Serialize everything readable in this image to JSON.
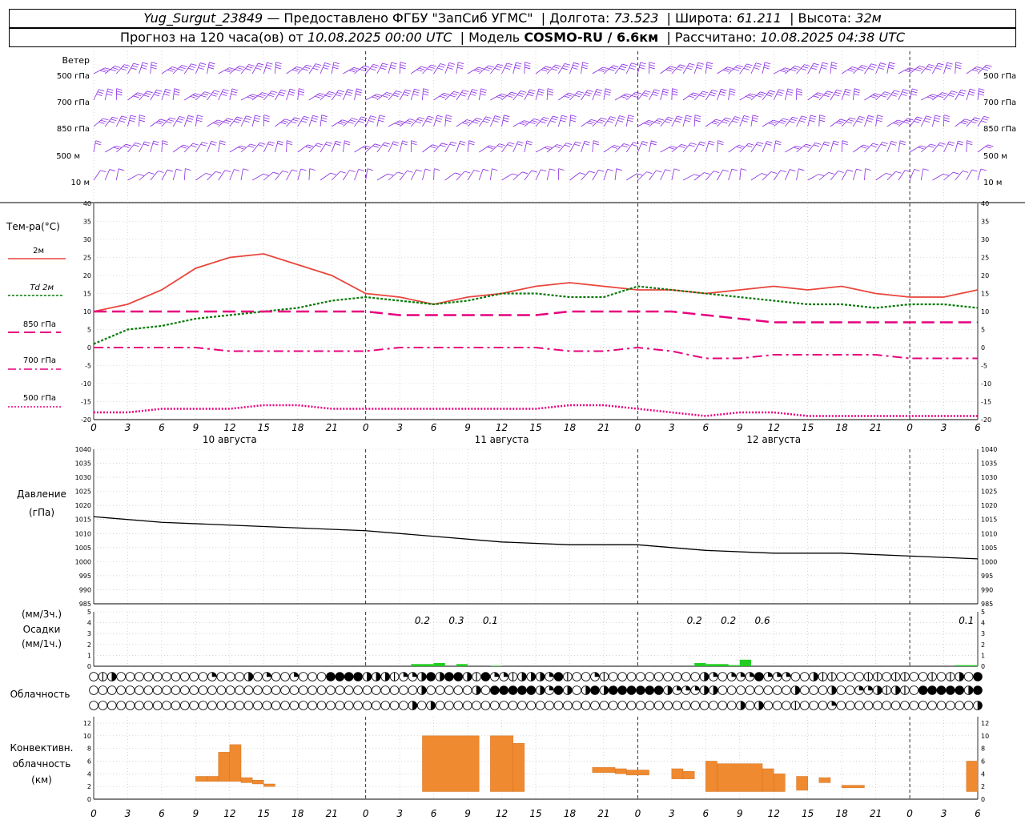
{
  "header": {
    "station": "Yug_Surgut_23849",
    "provider": "— Предоставлено ФГБУ \"ЗапСиб УГМС\"",
    "lon_label": "Долгота:",
    "lon_value": "73.523",
    "lat_label": "Широта:",
    "lat_value": "61.211",
    "alt_label": "Высота:",
    "alt_value": "32м",
    "forecast_prefix": "Прогноз на 120 часа(ов) от",
    "forecast_start": "10.08.2025 00:00 UTC",
    "model_label": "Модель",
    "model_value": "COSMO-RU / 6.6км",
    "calc_label": "Рассчитано:",
    "calc_value": "10.08.2025 04:38 UTC"
  },
  "wind_panel": {
    "title": "Ветер",
    "levels": [
      "500 гПа",
      "700 гПа",
      "850 гПа",
      "500 м",
      "10 м"
    ]
  },
  "axis": {
    "hour_labels": [
      "0",
      "3",
      "6",
      "9",
      "12",
      "15",
      "18",
      "21",
      "0",
      "3",
      "6",
      "9",
      "12",
      "15",
      "18",
      "21",
      "0",
      "3",
      "6",
      "9",
      "12",
      "15",
      "18",
      "21",
      "0",
      "3",
      "6"
    ],
    "day_labels": [
      "10 августа",
      "11 августа",
      "12 августа"
    ]
  },
  "colors": {
    "wind": "#8a2be2",
    "t2m": "#e8463c",
    "td2m": "#0a7a0a",
    "t850": "#e6007e",
    "pressure": "#000000",
    "precip": "#22cc22",
    "convective": "#f08a30"
  },
  "chart_data": [
    {
      "type": "line",
      "title": "Тем-ра(°C)",
      "ylim": [
        -20,
        40
      ],
      "y_ticks": [
        40,
        35,
        30,
        25,
        20,
        15,
        10,
        5,
        0,
        -5,
        -10,
        -15,
        -20
      ],
      "x_hours": [
        0,
        3,
        6,
        9,
        12,
        15,
        18,
        21,
        24,
        27,
        30,
        33,
        36,
        39,
        42,
        45,
        48,
        51,
        54,
        57,
        60,
        63,
        66,
        69,
        72,
        75,
        78
      ],
      "series": [
        {
          "name": "2м",
          "values": [
            10,
            12,
            16,
            22,
            25,
            26,
            23,
            20,
            15,
            14,
            12,
            14,
            15,
            17,
            18,
            17,
            16,
            16,
            15,
            16,
            17,
            16,
            17,
            15,
            14,
            14,
            16
          ]
        },
        {
          "name": "Td 2м",
          "values": [
            1,
            5,
            6,
            8,
            9,
            10,
            11,
            13,
            14,
            13,
            12,
            13,
            15,
            15,
            14,
            14,
            17,
            16,
            15,
            14,
            13,
            12,
            12,
            11,
            12,
            12,
            11
          ]
        },
        {
          "name": "850 гПа",
          "values": [
            10,
            10,
            10,
            10,
            10,
            10,
            10,
            10,
            10,
            9,
            9,
            9,
            9,
            9,
            10,
            10,
            10,
            10,
            9,
            8,
            7,
            7,
            7,
            7,
            7,
            7,
            7
          ]
        },
        {
          "name": "700 гПа",
          "values": [
            0,
            0,
            0,
            0,
            -1,
            -1,
            -1,
            -1,
            -1,
            0,
            0,
            0,
            0,
            0,
            -1,
            -1,
            0,
            -1,
            -3,
            -3,
            -2,
            -2,
            -2,
            -2,
            -3,
            -3,
            -3
          ]
        },
        {
          "name": "500 гПа",
          "values": [
            -18,
            -18,
            -17,
            -17,
            -17,
            -16,
            -16,
            -17,
            -17,
            -17,
            -17,
            -17,
            -17,
            -17,
            -16,
            -16,
            -17,
            -18,
            -19,
            -18,
            -18,
            -19,
            -19,
            -19,
            -19,
            -19,
            -19
          ]
        }
      ]
    },
    {
      "type": "line",
      "title": "Давление",
      "ylabel": "(гПа)",
      "ylim": [
        985,
        1040
      ],
      "y_ticks": [
        1040,
        1035,
        1030,
        1025,
        1020,
        1015,
        1010,
        1005,
        1000,
        995,
        990,
        985
      ],
      "x_hours": [
        0,
        6,
        12,
        18,
        24,
        30,
        36,
        42,
        48,
        54,
        60,
        66,
        72,
        78
      ],
      "series": [
        {
          "values": [
            1016,
            1014,
            1013,
            1012,
            1011,
            1009,
            1007,
            1006,
            1006,
            1004,
            1003,
            1003,
            1002,
            1001
          ]
        }
      ]
    },
    {
      "type": "bar",
      "title": "Осадки",
      "ylabel_top": "(мм/3ч.)",
      "ylabel_bottom": "(мм/1ч.)",
      "ylim": [
        0,
        5
      ],
      "y_ticks": [
        5,
        4,
        3,
        2,
        1,
        0
      ],
      "labels": [
        {
          "hour": 29,
          "text": "0.2"
        },
        {
          "hour": 32,
          "text": "0.3"
        },
        {
          "hour": 35,
          "text": "0.1"
        },
        {
          "hour": 53,
          "text": "0.2"
        },
        {
          "hour": 56,
          "text": "0.2"
        },
        {
          "hour": 59,
          "text": "0.6"
        },
        {
          "hour": 77,
          "text": "0.1"
        }
      ],
      "bars": [
        {
          "hour": 28.5,
          "value": 0.2
        },
        {
          "hour": 29.5,
          "value": 0.2
        },
        {
          "hour": 30.5,
          "value": 0.3
        },
        {
          "hour": 32.5,
          "value": 0.2
        },
        {
          "hour": 35.5,
          "value": 0.05
        },
        {
          "hour": 53.5,
          "value": 0.3
        },
        {
          "hour": 54.5,
          "value": 0.2
        },
        {
          "hour": 55.5,
          "value": 0.2
        },
        {
          "hour": 56.5,
          "value": 0.1
        },
        {
          "hour": 57.5,
          "value": 0.6
        },
        {
          "hour": 76.5,
          "value": 0.1
        },
        {
          "hour": 77.5,
          "value": 0.1
        }
      ]
    },
    {
      "type": "bar",
      "title": "Облачность",
      "rows": [
        [
          0,
          1,
          3,
          0,
          0,
          0,
          0,
          0,
          0,
          0,
          0,
          0,
          0,
          2,
          0,
          0,
          0,
          3,
          0,
          2,
          0,
          0,
          2,
          0,
          0,
          0,
          4,
          4,
          4,
          4,
          3,
          3,
          3,
          1,
          2,
          2,
          3,
          4,
          3,
          4,
          4,
          3,
          1,
          4,
          2,
          2,
          1,
          3,
          3,
          3,
          2,
          4,
          1,
          0,
          0,
          2,
          1,
          0,
          0,
          0,
          0,
          0,
          0,
          0,
          0,
          0,
          0,
          3,
          2,
          0,
          2,
          2,
          2,
          4,
          2,
          2,
          2,
          0,
          0,
          3,
          1,
          1,
          0,
          0,
          0,
          1,
          1,
          0,
          1,
          1,
          0,
          0,
          1,
          0,
          1,
          3,
          0,
          4
        ],
        [
          0,
          0,
          0,
          0,
          0,
          0,
          0,
          0,
          0,
          0,
          0,
          0,
          0,
          0,
          0,
          0,
          0,
          0,
          0,
          0,
          0,
          0,
          0,
          0,
          0,
          0,
          0,
          0,
          0,
          0,
          0,
          0,
          0,
          0,
          0,
          0,
          3,
          0,
          0,
          0,
          0,
          0,
          3,
          0,
          4,
          4,
          4,
          4,
          4,
          3,
          2,
          4,
          3,
          0,
          3,
          4,
          3,
          4,
          4,
          4,
          4,
          4,
          4,
          3,
          2,
          2,
          2,
          3,
          3,
          0,
          0,
          0,
          0,
          0,
          0,
          0,
          0,
          3,
          0,
          0,
          0,
          3,
          0,
          0,
          2,
          2,
          3,
          1,
          3,
          1,
          0,
          4,
          4,
          4,
          4,
          4,
          3,
          4
        ],
        [
          0,
          0,
          0,
          0,
          0,
          0,
          0,
          0,
          0,
          0,
          0,
          0,
          0,
          0,
          0,
          0,
          0,
          0,
          0,
          0,
          0,
          0,
          0,
          0,
          0,
          0,
          0,
          0,
          0,
          0,
          0,
          0,
          0,
          0,
          0,
          3,
          0,
          3,
          0,
          0,
          0,
          0,
          0,
          0,
          0,
          0,
          0,
          0,
          0,
          0,
          0,
          0,
          0,
          0,
          0,
          0,
          0,
          0,
          0,
          0,
          0,
          0,
          0,
          0,
          0,
          0,
          0,
          0,
          0,
          0,
          0,
          3,
          0,
          3,
          0,
          0,
          0,
          1,
          0,
          0,
          0,
          2,
          0,
          0,
          0,
          0,
          0,
          0,
          0,
          0,
          0,
          0,
          0,
          0,
          0,
          0,
          0,
          3
        ]
      ]
    },
    {
      "type": "bar",
      "title": "Конвективн. облачность",
      "ylabel": "(км)",
      "ylim": [
        0,
        13
      ],
      "y_ticks": [
        12,
        10,
        8,
        6,
        4,
        2,
        0
      ],
      "bars": [
        {
          "start": 9,
          "end": 10,
          "bottom": 2.8,
          "top": 3.6
        },
        {
          "start": 10,
          "end": 11,
          "bottom": 2.8,
          "top": 3.6
        },
        {
          "start": 11,
          "end": 12,
          "bottom": 2.8,
          "top": 7.4
        },
        {
          "start": 12,
          "end": 13,
          "bottom": 2.8,
          "top": 8.6
        },
        {
          "start": 13,
          "end": 14,
          "bottom": 2.6,
          "top": 3.4
        },
        {
          "start": 14,
          "end": 15,
          "bottom": 2.4,
          "top": 3.0
        },
        {
          "start": 15,
          "end": 16,
          "bottom": 2.0,
          "top": 2.4
        },
        {
          "start": 29,
          "end": 34,
          "bottom": 1.2,
          "top": 10
        },
        {
          "start": 35,
          "end": 37,
          "bottom": 1.2,
          "top": 10
        },
        {
          "start": 37,
          "end": 38,
          "bottom": 1.2,
          "top": 8.8
        },
        {
          "start": 44,
          "end": 46,
          "bottom": 4.2,
          "top": 5.0
        },
        {
          "start": 46,
          "end": 47,
          "bottom": 4.0,
          "top": 4.8
        },
        {
          "start": 47,
          "end": 49,
          "bottom": 3.8,
          "top": 4.6
        },
        {
          "start": 51,
          "end": 52,
          "bottom": 3.2,
          "top": 4.8
        },
        {
          "start": 52,
          "end": 53,
          "bottom": 3.2,
          "top": 4.4
        },
        {
          "start": 54,
          "end": 55,
          "bottom": 1.2,
          "top": 6.0
        },
        {
          "start": 55,
          "end": 59,
          "bottom": 1.2,
          "top": 5.6
        },
        {
          "start": 59,
          "end": 60,
          "bottom": 1.2,
          "top": 4.8
        },
        {
          "start": 60,
          "end": 61,
          "bottom": 1.2,
          "top": 4.0
        },
        {
          "start": 62,
          "end": 63,
          "bottom": 1.4,
          "top": 3.6
        },
        {
          "start": 64,
          "end": 65,
          "bottom": 2.6,
          "top": 3.4
        },
        {
          "start": 66,
          "end": 68,
          "bottom": 1.8,
          "top": 2.2
        },
        {
          "start": 77,
          "end": 78,
          "bottom": 1.2,
          "top": 6.0
        }
      ]
    }
  ]
}
